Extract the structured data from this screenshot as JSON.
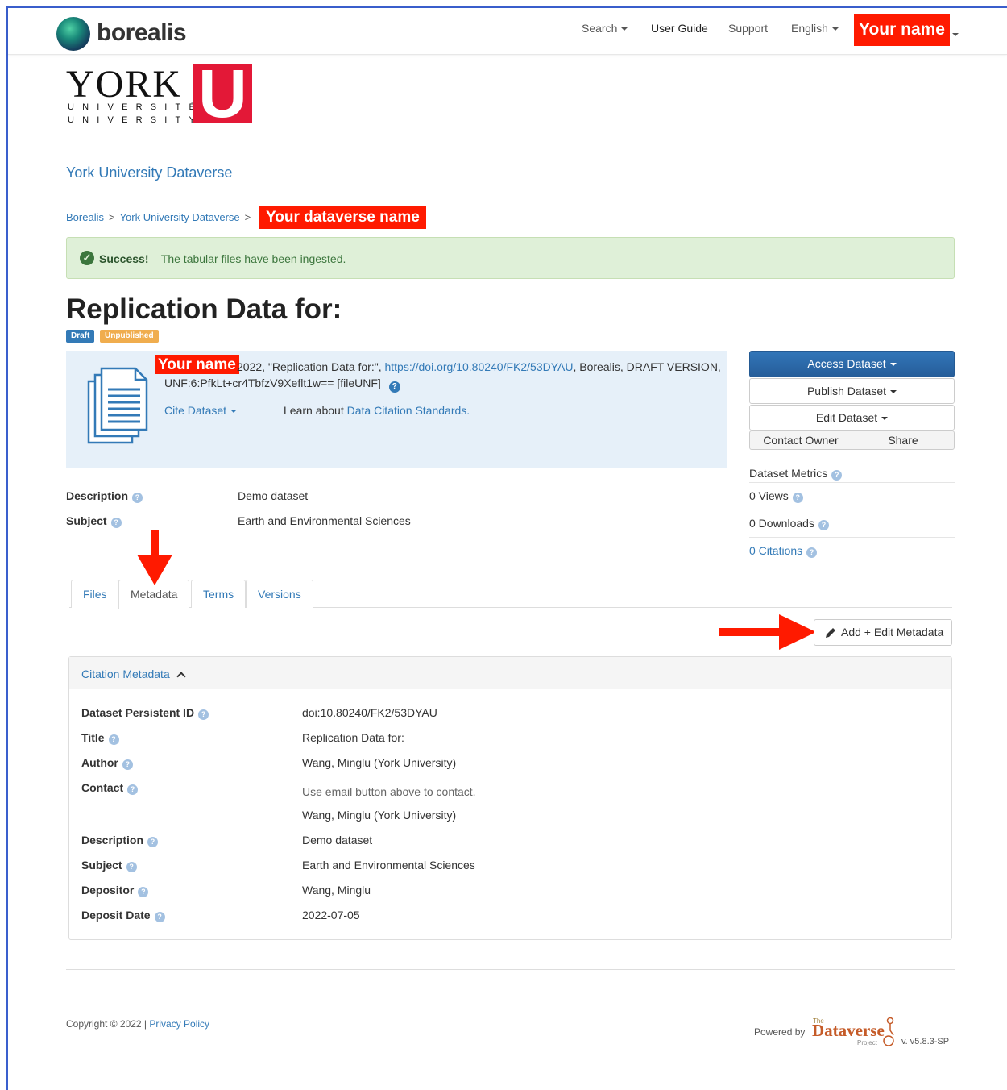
{
  "navbar": {
    "brand": "borealis",
    "items": [
      {
        "label": "Search",
        "dropdown": true
      },
      {
        "label": "User Guide",
        "dropdown": false
      },
      {
        "label": "Support",
        "dropdown": false
      },
      {
        "label": "English",
        "dropdown": true
      }
    ],
    "user": "Your name"
  },
  "logo": {
    "word": "YORK",
    "line1": "UNIVERSITÉ",
    "line2": "UNIVERSITY",
    "letter": "U"
  },
  "dataverse_title": "York University Dataverse",
  "breadcrumb": {
    "items": [
      "Borealis",
      "York University Dataverse"
    ],
    "separator": ">",
    "current": "Your dataverse name"
  },
  "alert": {
    "strong": "Success!",
    "message": "– The tabular files have been ingested."
  },
  "dataset": {
    "title": "Replication Data for:",
    "badges": [
      "Draft",
      "Unpublished"
    ]
  },
  "citation": {
    "author": "Your name",
    "text_before_link": "2022, \"Replication Data for:\",",
    "doi_link": "https://doi.org/10.80240/FK2/53DYAU",
    "text_after_link": ", Borealis, DRAFT VERSION,",
    "unf": "UNF:6:PfkLt+cr4TbfzV9Xeflt1w== [fileUNF]",
    "cite_button": "Cite Dataset",
    "learn_prefix": "Learn about",
    "learn_link": "Data Citation Standards."
  },
  "actions": {
    "access": "Access Dataset",
    "publish": "Publish Dataset",
    "edit": "Edit Dataset",
    "contact": "Contact Owner",
    "share": "Share"
  },
  "metrics": {
    "title": "Dataset Metrics",
    "views": "0 Views",
    "downloads": "0 Downloads",
    "citations": "0 Citations"
  },
  "summary": [
    {
      "label": "Description",
      "value": "Demo dataset"
    },
    {
      "label": "Subject",
      "value": "Earth and Environmental Sciences"
    }
  ],
  "tabs": [
    "Files",
    "Metadata",
    "Terms",
    "Versions"
  ],
  "active_tab": "Metadata",
  "edit_metadata_button": "Add + Edit Metadata",
  "citation_metadata": {
    "header": "Citation Metadata",
    "fields": {
      "persistent_id": {
        "label": "Dataset Persistent ID",
        "value": "doi:10.80240/FK2/53DYAU"
      },
      "title": {
        "label": "Title",
        "value": "Replication Data for:"
      },
      "author": {
        "label": "Author",
        "value": "Wang, Minglu (York University)"
      },
      "contact": {
        "label": "Contact",
        "value_note": "Use email button above to contact.",
        "value": "Wang, Minglu (York University)"
      },
      "description": {
        "label": "Description",
        "value": "Demo dataset"
      },
      "subject": {
        "label": "Subject",
        "value": "Earth and Environmental Sciences"
      },
      "depositor": {
        "label": "Depositor",
        "value": "Wang, Minglu"
      },
      "deposit_date": {
        "label": "Deposit Date",
        "value": "2022-07-05"
      }
    }
  },
  "footer": {
    "copyright": "Copyright © 2022 |",
    "privacy": "Privacy Policy",
    "powered_by": "Powered by",
    "logo_the": "The",
    "logo_name": "Dataverse",
    "logo_project": "Project",
    "version": "v. v5.8.3-SP"
  },
  "colors": {
    "link": "#337ab7",
    "annotation_red": "#ff1a00",
    "success_bg": "#dff0d8",
    "cite_bg": "#e6f0f9",
    "primary_btn": "#2a67a8",
    "badge_draft": "#337ab7",
    "badge_unpublished": "#f0ad4e"
  }
}
